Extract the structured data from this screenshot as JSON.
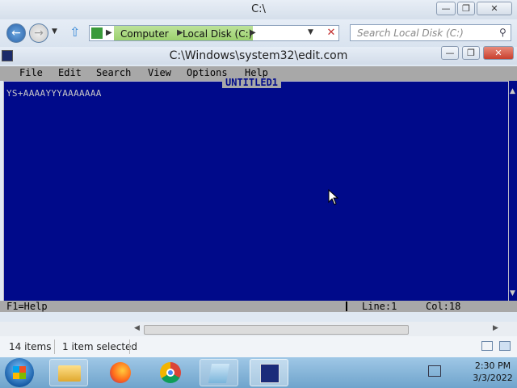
{
  "explorer": {
    "title": "C:\\",
    "breadcrumbs": [
      "Computer",
      "Local Disk (C:)"
    ],
    "search_placeholder": "Search Local Disk (C:)",
    "status_items": "14 items",
    "status_selected": "1 item selected"
  },
  "edit": {
    "window_title": "C:\\Windows\\system32\\edit.com",
    "menu": [
      "File",
      "Edit",
      "Search",
      "View",
      "Options",
      "Help"
    ],
    "doc_title": "UNTITLED1",
    "content": "YS+AAAAYYYAAAAAAA",
    "status_help": "F1=Help",
    "status_line": "Line:1",
    "status_col": "Col:18"
  },
  "taskbar": {
    "time": "2:30 PM",
    "date": "3/3/2022"
  },
  "colors": {
    "editor_bg": "#000a8a",
    "menu_bg": "#a8a8a8",
    "taskbar": "#7fb0d6"
  }
}
